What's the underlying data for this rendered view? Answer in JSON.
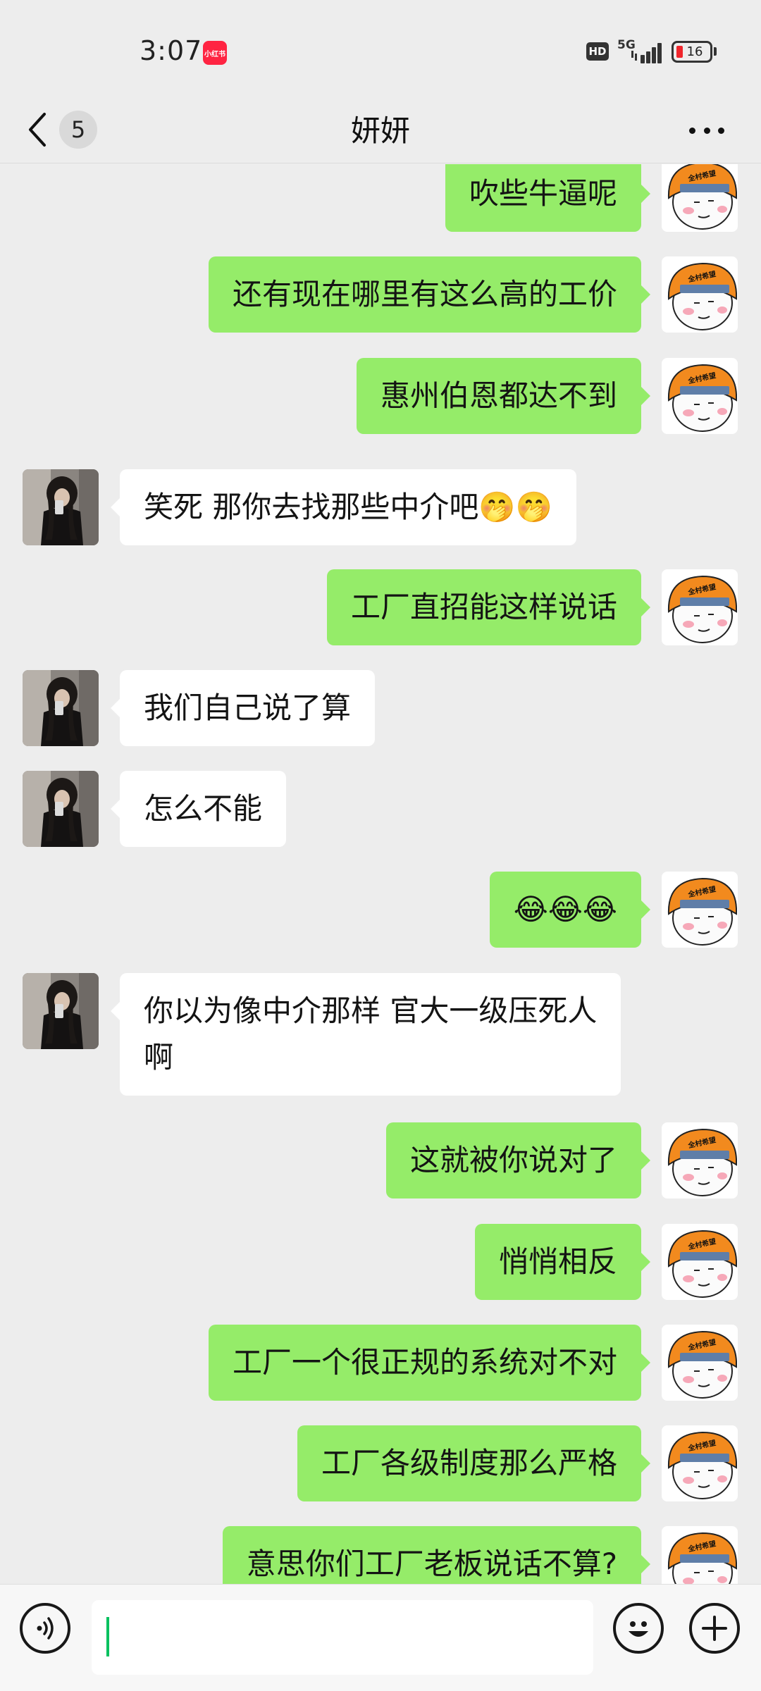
{
  "status_bar": {
    "time": "3:07",
    "app_badge": "小红书",
    "hd": "HD",
    "network": "5G",
    "battery": "16"
  },
  "nav": {
    "title": "妍妍",
    "unread_count": "5"
  },
  "messages": [
    {
      "side": "out",
      "text": "吹些牛逼呢"
    },
    {
      "side": "out",
      "text": "还有现在哪里有这么高的工价"
    },
    {
      "side": "out",
      "text": "惠州伯恩都达不到"
    },
    {
      "side": "in",
      "text": "笑死 那你去找那些中介吧🤭🤭"
    },
    {
      "side": "out",
      "text": "工厂直招能这样说话"
    },
    {
      "side": "in",
      "text": "我们自己说了算"
    },
    {
      "side": "in",
      "text": "怎么不能"
    },
    {
      "side": "out",
      "text": "😂😂😂"
    },
    {
      "side": "in",
      "text": "你以为像中介那样 官大一级压死人\n啊"
    },
    {
      "side": "out",
      "text": "这就被你说对了"
    },
    {
      "side": "out",
      "text": "悄悄相反"
    },
    {
      "side": "out",
      "text": "工厂一个很正规的系统对不对"
    },
    {
      "side": "out",
      "text": "工厂各级制度那么严格"
    },
    {
      "side": "out",
      "text": "意思你们工厂老板说话不算?"
    }
  ],
  "avatars": {
    "self_helmet_text": "全村希望"
  },
  "input": {
    "value": "",
    "placeholder": ""
  },
  "icons": {
    "back": "chevron-left-icon",
    "more": "more-horizontal-icon",
    "voice": "voice-icon",
    "emoji": "emoji-icon",
    "plus": "plus-icon"
  },
  "colors": {
    "background": "#ededed",
    "outgoing_bubble": "#95ec69",
    "incoming_bubble": "#ffffff",
    "accent": "#07c160"
  }
}
